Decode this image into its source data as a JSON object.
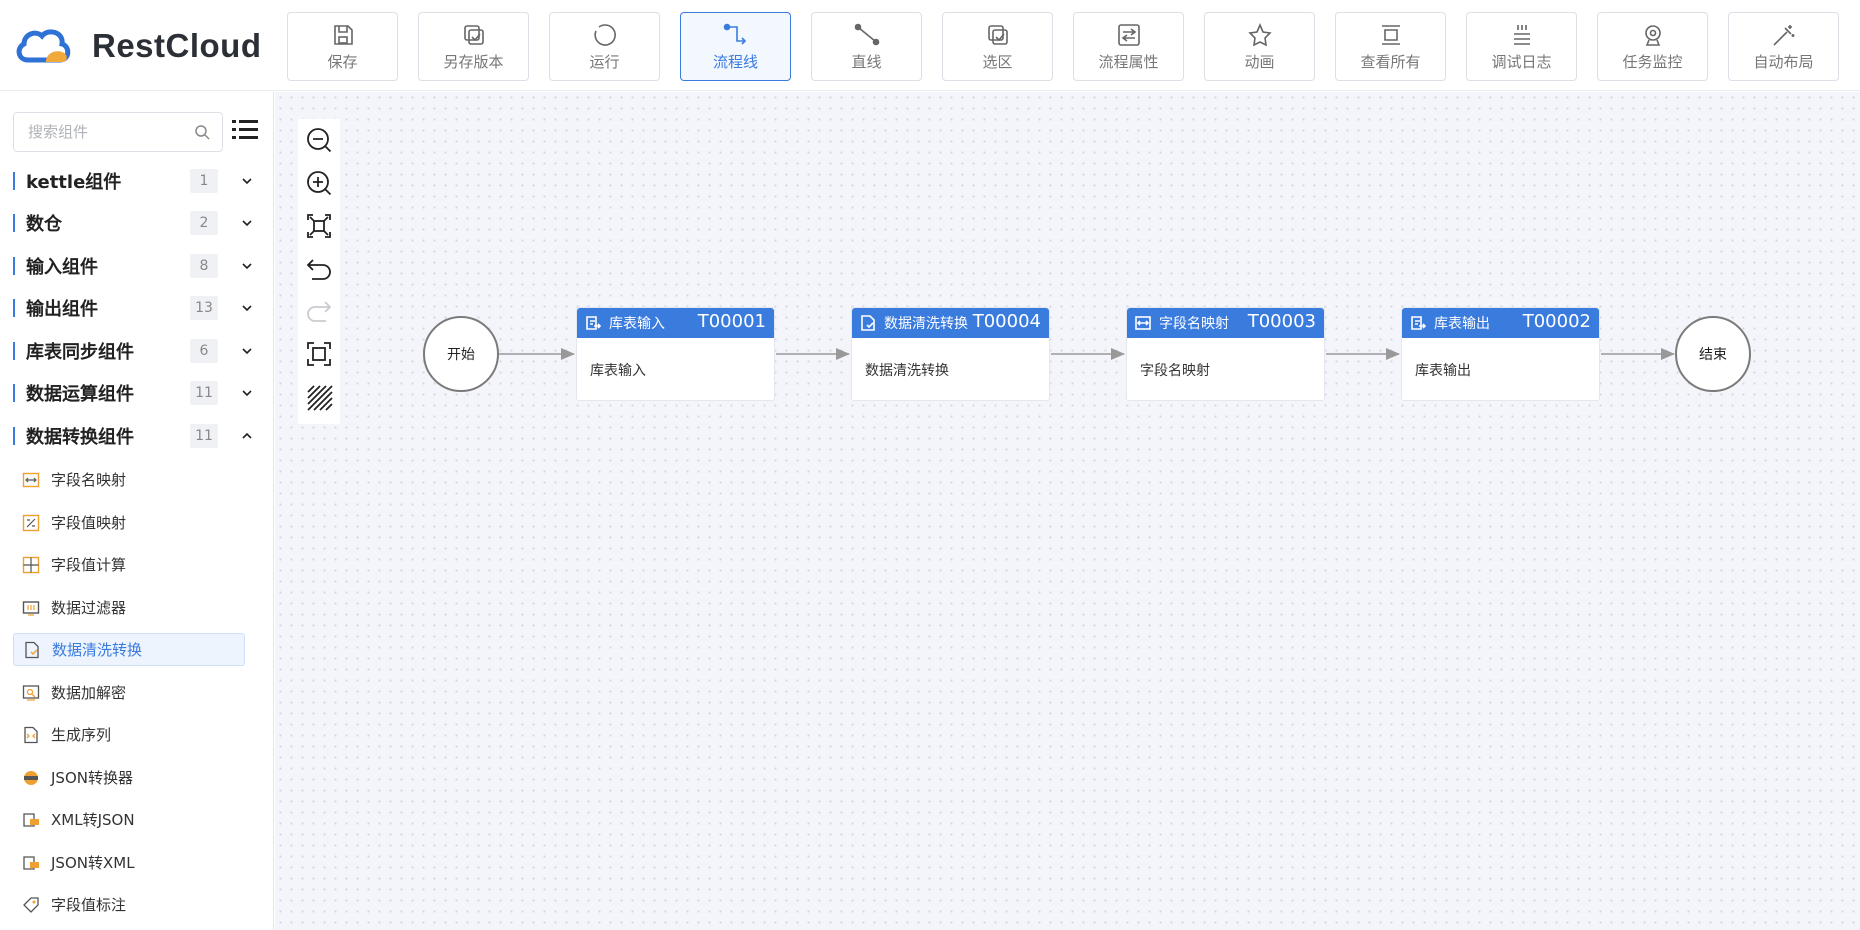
{
  "app": {
    "logo_text": "RestCloud"
  },
  "toolbar": [
    {
      "icon": "save-icon",
      "label": "保存",
      "active": false
    },
    {
      "icon": "save-version-icon",
      "label": "另存版本",
      "active": false
    },
    {
      "icon": "run-icon",
      "label": "运行",
      "active": false
    },
    {
      "icon": "flow-line-icon",
      "label": "流程线",
      "active": true
    },
    {
      "icon": "straight-line-icon",
      "label": "直线",
      "active": false
    },
    {
      "icon": "select-area-icon",
      "label": "选区",
      "active": false
    },
    {
      "icon": "flow-properties-icon",
      "label": "流程属性",
      "active": false
    },
    {
      "icon": "animation-icon",
      "label": "动画",
      "active": false
    },
    {
      "icon": "view-all-icon",
      "label": "查看所有",
      "active": false
    },
    {
      "icon": "debug-log-icon",
      "label": "调试日志",
      "active": false
    },
    {
      "icon": "task-monitor-icon",
      "label": "任务监控",
      "active": false
    },
    {
      "icon": "auto-layout-icon",
      "label": "自动布局",
      "active": false
    }
  ],
  "sidebar": {
    "search_placeholder": "搜索组件",
    "categories": [
      {
        "name": "kettle组件",
        "count": "1",
        "expanded": false
      },
      {
        "name": "数仓",
        "count": "2",
        "expanded": false
      },
      {
        "name": "输入组件",
        "count": "8",
        "expanded": false
      },
      {
        "name": "输出组件",
        "count": "13",
        "expanded": false
      },
      {
        "name": "库表同步组件",
        "count": "6",
        "expanded": false
      },
      {
        "name": "数据运算组件",
        "count": "11",
        "expanded": false
      },
      {
        "name": "数据转换组件",
        "count": "11",
        "expanded": true
      }
    ],
    "items": [
      {
        "label": "字段名映射",
        "icon": "field-name-mapping-icon",
        "selected": false
      },
      {
        "label": "字段值映射",
        "icon": "field-value-mapping-icon",
        "selected": false
      },
      {
        "label": "字段值计算",
        "icon": "field-value-calc-icon",
        "selected": false
      },
      {
        "label": "数据过滤器",
        "icon": "data-filter-icon",
        "selected": false
      },
      {
        "label": "数据清洗转换",
        "icon": "data-cleansing-icon",
        "selected": true
      },
      {
        "label": "数据加解密",
        "icon": "data-encrypt-icon",
        "selected": false
      },
      {
        "label": "生成序列",
        "icon": "generate-sequence-icon",
        "selected": false
      },
      {
        "label": "JSON转换器",
        "icon": "json-converter-icon",
        "selected": false
      },
      {
        "label": "XML转JSON",
        "icon": "xml-to-json-icon",
        "selected": false
      },
      {
        "label": "JSON转XML",
        "icon": "json-to-xml-icon",
        "selected": false
      },
      {
        "label": "字段值标注",
        "icon": "field-tag-icon",
        "selected": false
      }
    ]
  },
  "canvas": {
    "zoom_tools": [
      {
        "icon": "zoom-out-icon",
        "enabled": true
      },
      {
        "icon": "zoom-in-icon",
        "enabled": true
      },
      {
        "icon": "fit-view-icon",
        "enabled": true
      },
      {
        "icon": "undo-icon",
        "enabled": true
      },
      {
        "icon": "redo-icon",
        "enabled": false
      },
      {
        "icon": "actual-size-icon",
        "enabled": true
      },
      {
        "icon": "grid-toggle-icon",
        "enabled": true
      }
    ],
    "start_label": "开始",
    "end_label": "结束",
    "nodes": [
      {
        "title": "库表输入",
        "id": "T00001",
        "body": "库表输入",
        "icon": "table-input-icon"
      },
      {
        "title": "数据清洗转换",
        "id": "T00004",
        "body": "数据清洗转换",
        "icon": "data-cleansing-icon"
      },
      {
        "title": "字段名映射",
        "id": "T00003",
        "body": "字段名映射",
        "icon": "field-name-mapping-icon"
      },
      {
        "title": "库表输出",
        "id": "T00002",
        "body": "库表输出",
        "icon": "table-output-icon"
      }
    ],
    "colors": {
      "node_header": "#3a7bde",
      "accent": "#3a7bde"
    }
  }
}
